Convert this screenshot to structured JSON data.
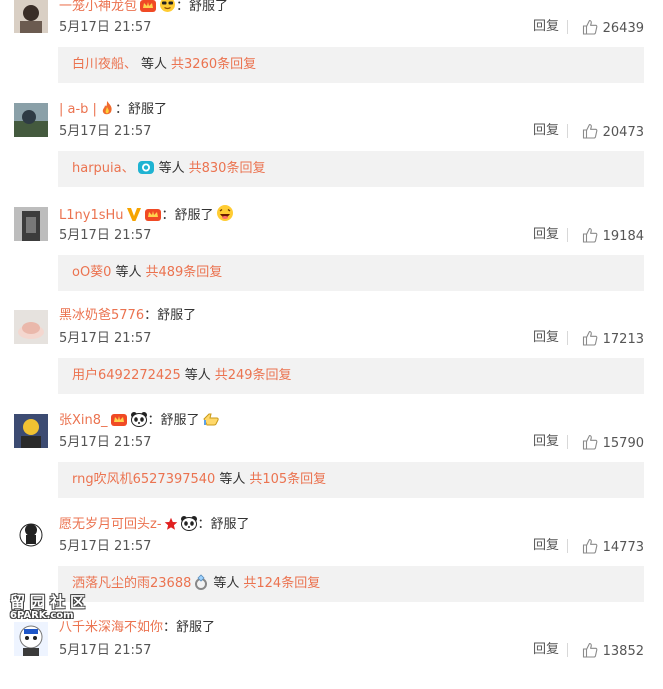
{
  "colors": {
    "username": "#eb7350",
    "reply_box_bg": "#f2f2f2",
    "text": "#333333",
    "meta": "#555555"
  },
  "comments": [
    {
      "username": "一笼小神龙包",
      "badges": [
        "vip-crown-badge",
        "cool-sunglasses-emoji"
      ],
      "content": "舒服了",
      "content_emojis": [],
      "time": "5月17日 21:57",
      "reply_label": "回复",
      "likes": "26439",
      "replies": {
        "users": "白川夜船、",
        "users_badge": null,
        "etc": "等人",
        "total": "共3260条回复"
      }
    },
    {
      "username": "| a-b |",
      "badges": [
        "fire-badge"
      ],
      "content": "舒服了",
      "content_emojis": [],
      "time": "5月17日 21:57",
      "reply_label": "回复",
      "likes": "20473",
      "replies": {
        "users": "harpuia、",
        "users_badge": "camera-badge",
        "etc": "等人",
        "total": "共830条回复"
      }
    },
    {
      "username": "L1ny1sHu",
      "badges": [
        "verified-v-badge",
        "vip-crown-badge"
      ],
      "content": "舒服了",
      "content_emojis": [
        "laughing-emoji"
      ],
      "time": "5月17日 21:57",
      "reply_label": "回复",
      "likes": "19184",
      "replies": {
        "users": "oO葵0",
        "users_badge": null,
        "etc": "等人",
        "total": "共489条回复"
      }
    },
    {
      "username": "黑冰奶爸5776",
      "badges": [],
      "content": "舒服了",
      "content_emojis": [],
      "time": "5月17日 21:57",
      "reply_label": "回复",
      "likes": "17213",
      "replies": {
        "users": "用户6492272425",
        "users_badge": null,
        "etc": "等人",
        "total": "共249条回复"
      }
    },
    {
      "username": "张Xin8_",
      "badges": [
        "vip-crown-badge",
        "panda-emoji"
      ],
      "content": "舒服了",
      "content_emojis": [
        "thumbs-emoji"
      ],
      "time": "5月17日 21:57",
      "reply_label": "回复",
      "likes": "15790",
      "replies": {
        "users": "rng吹风机6527397540",
        "users_badge": null,
        "etc": "等人",
        "total": "共105条回复"
      }
    },
    {
      "username": "愿无岁月可回头z-",
      "badges": [
        "red-star-badge",
        "panda-emoji"
      ],
      "content": "舒服了",
      "content_emojis": [],
      "time": "5月17日 21:57",
      "reply_label": "回复",
      "likes": "14773",
      "replies": {
        "users": "洒落凡尘的雨23688",
        "users_badge": "diamond-ring-badge",
        "etc": "等人",
        "total": "共124条回复"
      }
    },
    {
      "username": "八千米深海不如你",
      "badges": [],
      "content": "舒服了",
      "content_emojis": [],
      "time": "5月17日 21:57",
      "reply_label": "回复",
      "likes": "13852",
      "replies": null
    }
  ],
  "watermark": {
    "chars": "留园社区",
    "url": "6PARK.com"
  }
}
